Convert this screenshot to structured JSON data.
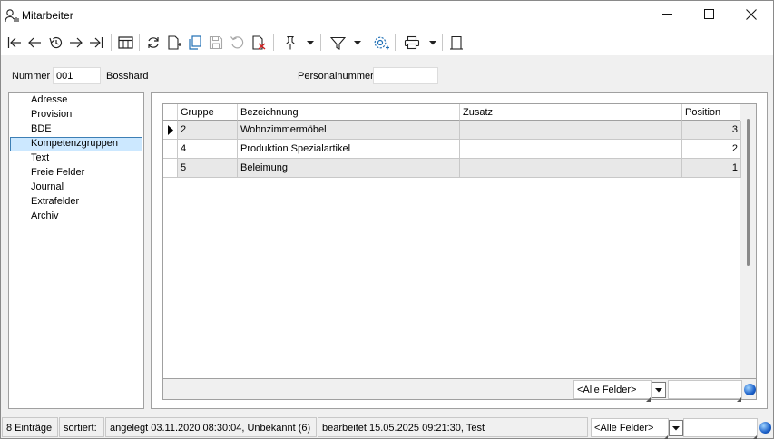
{
  "window": {
    "title": "Mitarbeiter",
    "minimize_icon": "minimize-icon",
    "maximize_icon": "maximize-icon",
    "close_icon": "close-icon"
  },
  "toolbar": {
    "icons": [
      "first-record-icon",
      "previous-record-icon",
      "history-icon",
      "next-record-icon",
      "last-record-icon",
      "table-view-icon",
      "refresh-icon",
      "new-record-icon",
      "copy-record-icon",
      "save-icon",
      "undo-icon",
      "delete-icon",
      "pin-icon",
      "filter-icon",
      "settings-icon",
      "print-icon",
      "exit-icon"
    ]
  },
  "header": {
    "nummer_label": "Nummer",
    "nummer_value": "001",
    "name": "Bosshard",
    "personalnummer_label": "Personalnummer",
    "personalnummer_value": ""
  },
  "nav": {
    "items": [
      {
        "label": "Adresse",
        "selected": false
      },
      {
        "label": "Provision",
        "selected": false
      },
      {
        "label": "BDE",
        "selected": false
      },
      {
        "label": "Kompetenzgruppen",
        "selected": true
      },
      {
        "label": "Text",
        "selected": false
      },
      {
        "label": "Freie Felder",
        "selected": false
      },
      {
        "label": "Journal",
        "selected": false
      },
      {
        "label": "Extrafelder",
        "selected": false
      },
      {
        "label": "Archiv",
        "selected": false
      }
    ]
  },
  "grid": {
    "columns": [
      "Gruppe",
      "Bezeichnung",
      "Zusatz",
      "Position"
    ],
    "rows": [
      {
        "gruppe": "2",
        "bezeichnung": "Wohnzimmermöbel",
        "zusatz": "",
        "position": "3",
        "current": true
      },
      {
        "gruppe": "4",
        "bezeichnung": "Produktion Spezialartikel",
        "zusatz": "",
        "position": "2",
        "current": false
      },
      {
        "gruppe": "5",
        "bezeichnung": "Beleimung",
        "zusatz": "",
        "position": "1",
        "current": false
      }
    ],
    "filter_combo": "<Alle Felder>",
    "search_value": ""
  },
  "status": {
    "count": "8 Einträge",
    "sorted_label": "sortiert:",
    "created": "angelegt 03.11.2020 08:30:04, Unbekannt (6)",
    "edited": "bearbeitet 15.05.2025 09:21:30, Test",
    "filter_combo": "<Alle Felder>",
    "search_value": ""
  },
  "colors": {
    "selection_bg": "#cce8ff",
    "selection_border": "#3d7fb5",
    "row_alt": "#e8e8e8"
  }
}
